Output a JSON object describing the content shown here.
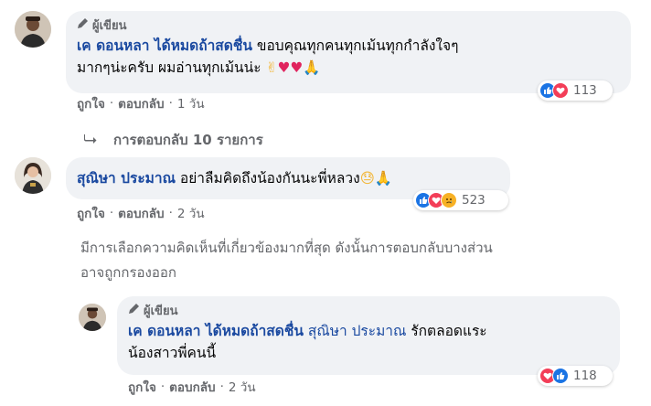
{
  "comment1": {
    "badge": "ผู้เขียน",
    "author": "เค ดอนหลา ได้หมดถ้าสดชื่น",
    "text_line1": "ขอบคุณทุกคนทุกเม้นทุกกำลังใจๆ",
    "text_line2": "มากๆน่ะครับ ผมอ่านทุกเม้นน่ะ",
    "emojis": "✌",
    "hearts": "♥♥",
    "pray": "🙏",
    "like_label": "ถูกใจ",
    "reply_label": "ตอบกลับ",
    "time": "1 วัน",
    "reaction_count": "113",
    "reaction_icons": [
      "like-icon",
      "love-icon"
    ]
  },
  "view_replies": {
    "label": "การตอบกลับ 10 รายการ"
  },
  "comment2": {
    "author": "สุณิษา ประมาณ",
    "text": "อย่าลืมคิดถึงน้องกันนะพี่หลวง",
    "emojis": "😓🙏",
    "like_label": "ถูกใจ",
    "reply_label": "ตอบกลับ",
    "time": "2 วัน",
    "reaction_count": "523",
    "reaction_icons": [
      "like-icon",
      "love-icon",
      "sad-icon"
    ]
  },
  "notice": {
    "line1": "มีการเลือกความคิดเห็นที่เกี่ยวข้องมากที่สุด ดังนั้นการตอบกลับบางส่วน",
    "line2": "อาจถูกกรองออก"
  },
  "reply1": {
    "badge": "ผู้เขียน",
    "author": "เค ดอนหลา ได้หมดถ้าสดชื่น",
    "mention": "สุณิษา ประมาณ",
    "text_line1": "รักตลอดแระ",
    "text_line2": "น้องสาวพี่คนนี้",
    "like_label": "ถูกใจ",
    "reply_label": "ตอบกลับ",
    "time": "2 วัน",
    "reaction_count": "118",
    "reaction_icons": [
      "love-icon",
      "like-icon"
    ]
  },
  "separator": "·",
  "colors": {
    "bubble": "#f0f2f5",
    "name": "#1a49a0",
    "meta": "#65676b",
    "like": "#1b74e4",
    "love": "#f33e58",
    "sad": "#f7b125"
  }
}
